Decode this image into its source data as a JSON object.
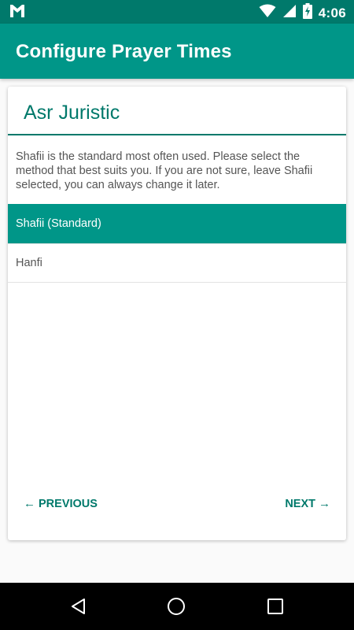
{
  "status_bar": {
    "time": "4:06",
    "icons": [
      "gmail-icon",
      "wifi-icon",
      "signal-icon",
      "battery-charging-icon"
    ]
  },
  "app_bar": {
    "title": "Configure Prayer Times"
  },
  "card": {
    "title": "Asr Juristic",
    "description": "Shafii is the standard most often used. Please select the method that best suits you. If you are not sure, leave Shafii selected, you can always change it later.",
    "options": [
      {
        "label": "Shafii (Standard)",
        "selected": true
      },
      {
        "label": "Hanfi",
        "selected": false
      }
    ],
    "previous_label": "PREVIOUS",
    "next_label": "NEXT",
    "previous_arrow": "←",
    "next_arrow": "→"
  },
  "nav_bar": {
    "icons": [
      "back-icon",
      "home-icon",
      "recents-icon"
    ]
  },
  "colors": {
    "primary": "#009688",
    "primary_dark": "#00796b",
    "accent_text": "#00796b"
  }
}
